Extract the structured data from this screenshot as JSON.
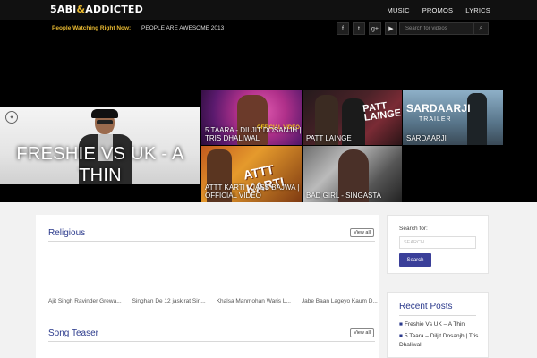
{
  "header": {
    "logo_left": "5ABI",
    "logo_amp": "&",
    "logo_right": "ADDICTED",
    "nav": [
      "MUSIC",
      "PROMOS",
      "LYRICS"
    ]
  },
  "subbar": {
    "watching_label": "People Watching Right Now:",
    "watching_text": "PEOPLE ARE AWESOME 2013",
    "socials": [
      {
        "icon": "facebook-icon",
        "glyph": "f"
      },
      {
        "icon": "twitter-icon",
        "glyph": "t"
      },
      {
        "icon": "google-plus-icon",
        "glyph": "g+"
      },
      {
        "icon": "youtube-icon",
        "glyph": "▶"
      }
    ],
    "search_placeholder": "Search for videos",
    "search_icon": "⌕"
  },
  "featured": {
    "big": {
      "title": "FRESHIE VS UK - A THIN"
    },
    "tiles": [
      {
        "caption": "5 TAARA - DILJIT DOSANJH | TRIS DHALIWAL",
        "note": "OFFICIAL VIDEO"
      },
      {
        "caption": "PATT LAINGE",
        "overlay": "PATT LAINGE"
      },
      {
        "caption": "SARDAARJI",
        "overlay": "SARDAARJI",
        "overlay_sub": "TRAILER"
      },
      {
        "caption": "ATTT KARTI - JASS BAJWA | OFFICIAL VIDEO",
        "overlay": "ATTT KARTI"
      },
      {
        "caption": "BAD GIRL - SINGASTA"
      }
    ]
  },
  "religious": {
    "title": "Religious",
    "view_all": "View all",
    "videos": [
      "Ajit Singh Ravinder Grewa...",
      "Singhan De 12 jaskirat Sin...",
      "Khalsa Manmohan Waris L...",
      "Jabe Baan Lageyo Kaum D..."
    ]
  },
  "teaser": {
    "title": "Song Teaser",
    "view_all": "View all"
  },
  "sidebar": {
    "search_label": "Search for:",
    "search_placeholder": "SEARCH",
    "search_button": "Search",
    "recent_title": "Recent Posts",
    "recent": [
      "Freshie Vs UK – A Thin",
      "5 Taara – Diljit Dosanjh | Tris Dhaliwal"
    ]
  },
  "colors": {
    "accent": "#2b3a8c",
    "gold": "#e8b931",
    "button": "#3a3f99"
  }
}
